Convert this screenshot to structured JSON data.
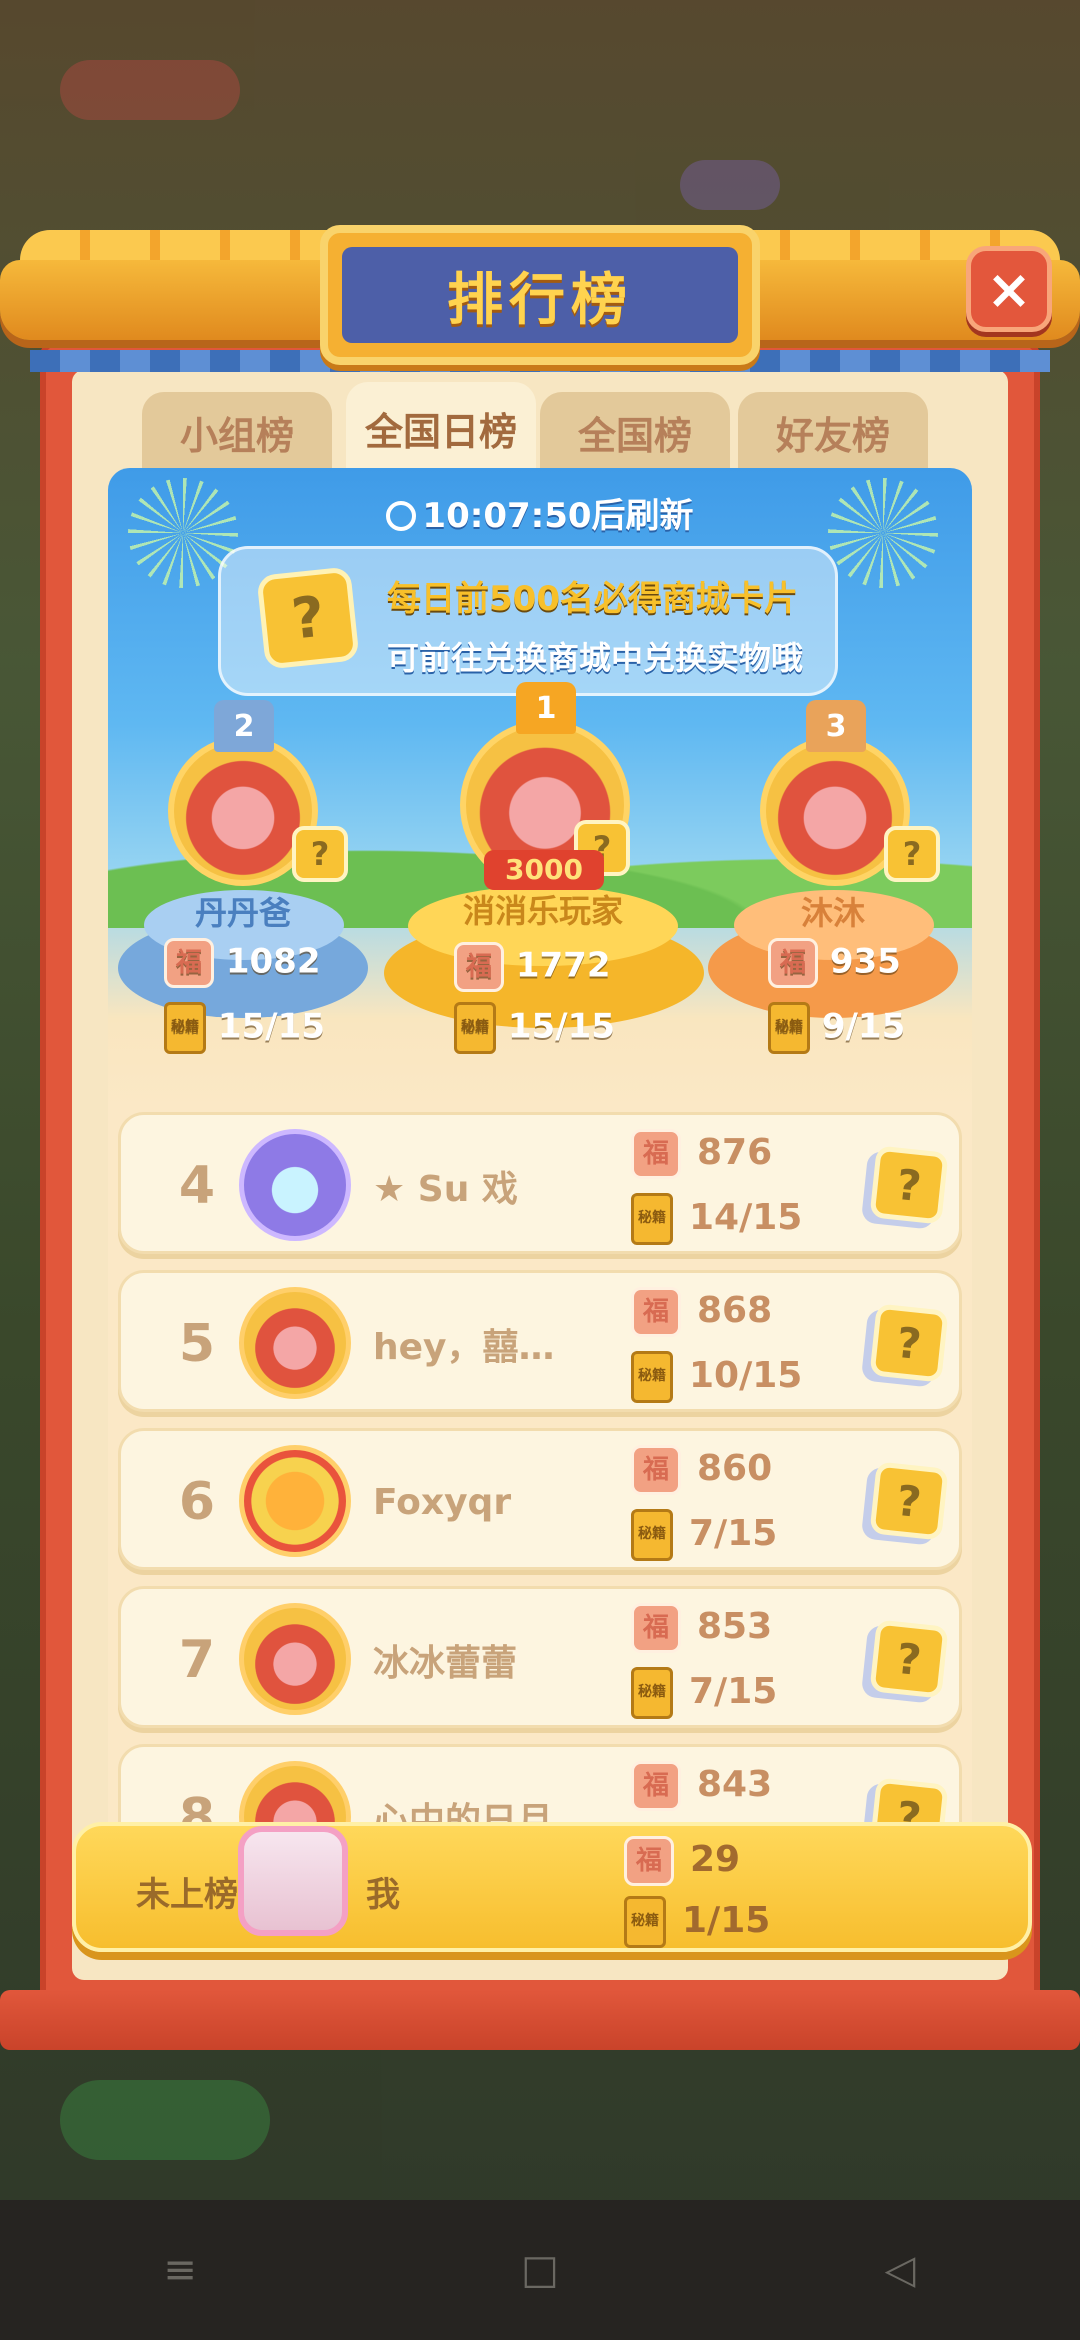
{
  "header": {
    "title": "排行榜",
    "close_icon": "×"
  },
  "tabs": [
    {
      "label": "小组榜",
      "active": false
    },
    {
      "label": "全国日榜",
      "active": true
    },
    {
      "label": "全国榜",
      "active": false
    },
    {
      "label": "好友榜",
      "active": false
    }
  ],
  "banner": {
    "timer": "10:07:50后刷新",
    "info_line1": "每日前500名必得商城卡片",
    "info_line2": "可前往兑换商城中兑换实物哦",
    "card_symbol": "?"
  },
  "podium": [
    {
      "rank": "1",
      "name": "消消乐玩家",
      "score": "1772",
      "pages": "15/15",
      "badge": "3000"
    },
    {
      "rank": "2",
      "name": "丹丹爸",
      "score": "1082",
      "pages": "15/15"
    },
    {
      "rank": "3",
      "name": "沐沐",
      "score": "935",
      "pages": "9/15"
    }
  ],
  "rows": [
    {
      "rank": "4",
      "name": "★ Su 戏",
      "score": "876",
      "pages": "14/15"
    },
    {
      "rank": "5",
      "name": "hey，囍…",
      "score": "868",
      "pages": "10/15"
    },
    {
      "rank": "6",
      "name": "Foxyqr",
      "score": "860",
      "pages": "7/15"
    },
    {
      "rank": "7",
      "name": "冰冰蕾蕾",
      "score": "853",
      "pages": "7/15"
    },
    {
      "rank": "8",
      "name": "心中的日月",
      "score": "843",
      "pages": ""
    }
  ],
  "self": {
    "rank": "未上榜",
    "name": "我",
    "score": "29",
    "pages": "1/15"
  },
  "icons": {
    "score": "福",
    "book": "秘籍",
    "card": "?"
  },
  "navbar": {
    "menu": "≡",
    "home": "□",
    "back": "◁"
  },
  "colors": {
    "panel": "#e1573b",
    "plaque": "#4d5fa8",
    "gold": "#f7be2e"
  }
}
